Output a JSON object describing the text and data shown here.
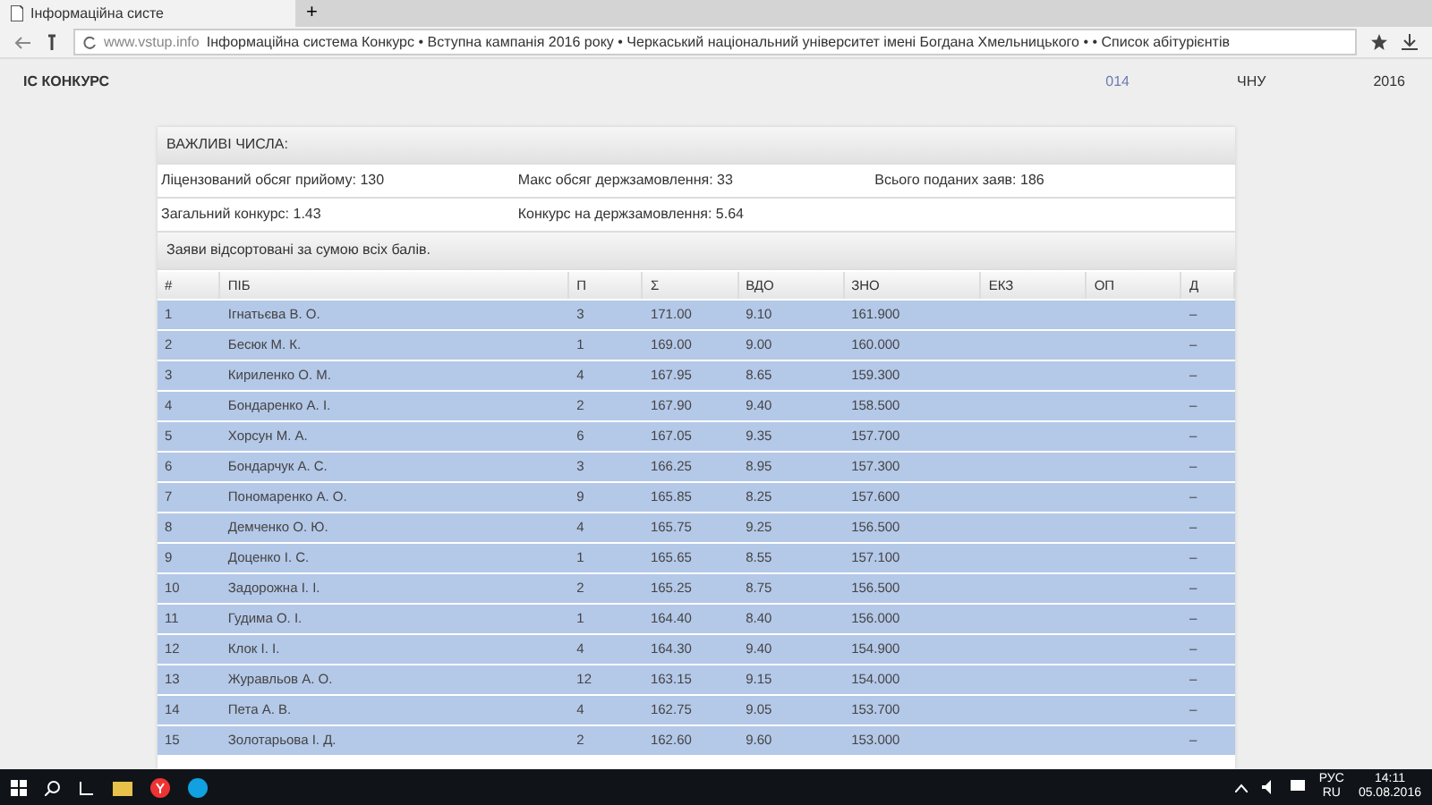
{
  "browser": {
    "tab": {
      "title": "Інформаційна систе",
      "selected": true
    },
    "new_tab": "+",
    "url_host": "www.vstup.info",
    "url_title": "Інформаційна система Конкурс • Вступна кампанія 2016 року • Черкаський національний університет імені Богдана Хмельницького • • Список абітурієнтів"
  },
  "navbar": {
    "brand": "ІС КОНКУРС",
    "links": [
      {
        "label": "014",
        "selected": true
      },
      {
        "label": "ЧНУ",
        "selected": false
      },
      {
        "label": "2016",
        "selected": false
      }
    ]
  },
  "panel": {
    "title": "ВАЖЛИВІ ЧИСЛА:",
    "stats": [
      [
        "Ліцензований обсяг прийому: 130",
        "Макс обсяг держзамовлення: 33",
        "Всього поданих заяв: 186"
      ],
      [
        "Загальний конкурс: 1.43",
        "Конкурс на держзамовлення: 5.64"
      ]
    ],
    "note": "Заяви відсортовані за сумою всіх балів."
  },
  "table": {
    "columns": [
      "#",
      "ПІБ",
      "П",
      "Σ",
      "ВДО",
      "ЗНО",
      "ЕКЗ",
      "ОП",
      "Д"
    ],
    "rows": [
      [
        "1",
        "Ігнатьєва В. О.",
        "3",
        "171.00",
        "9.10",
        "161.900",
        "",
        "",
        "–"
      ],
      [
        "2",
        "Бесюк М. К.",
        "1",
        "169.00",
        "9.00",
        "160.000",
        "",
        "",
        "–"
      ],
      [
        "3",
        "Кириленко О. М.",
        "4",
        "167.95",
        "8.65",
        "159.300",
        "",
        "",
        "–"
      ],
      [
        "4",
        "Бондаренко А. І.",
        "2",
        "167.90",
        "9.40",
        "158.500",
        "",
        "",
        "–"
      ],
      [
        "5",
        "Хорсун М. А.",
        "6",
        "167.05",
        "9.35",
        "157.700",
        "",
        "",
        "–"
      ],
      [
        "6",
        "Бондарчук А. С.",
        "3",
        "166.25",
        "8.95",
        "157.300",
        "",
        "",
        "–"
      ],
      [
        "7",
        "Пономаренко А. О.",
        "9",
        "165.85",
        "8.25",
        "157.600",
        "",
        "",
        "–"
      ],
      [
        "8",
        "Демченко О. Ю.",
        "4",
        "165.75",
        "9.25",
        "156.500",
        "",
        "",
        "–"
      ],
      [
        "9",
        "Доценко І. С.",
        "1",
        "165.65",
        "8.55",
        "157.100",
        "",
        "",
        "–"
      ],
      [
        "10",
        "Задорожна І. І.",
        "2",
        "165.25",
        "8.75",
        "156.500",
        "",
        "",
        "–"
      ],
      [
        "11",
        "Гудима О. І.",
        "1",
        "164.40",
        "8.40",
        "156.000",
        "",
        "",
        "–"
      ],
      [
        "12",
        "Клок І. І.",
        "4",
        "164.30",
        "9.40",
        "154.900",
        "",
        "",
        "–"
      ],
      [
        "13",
        "Журавльов А. О.",
        "12",
        "163.15",
        "9.15",
        "154.000",
        "",
        "",
        "–"
      ],
      [
        "14",
        "Пета А. В.",
        "4",
        "162.75",
        "9.05",
        "153.700",
        "",
        "",
        "–"
      ],
      [
        "15",
        "Золотарьова І. Д.",
        "2",
        "162.60",
        "9.60",
        "153.000",
        "",
        "",
        "–"
      ]
    ]
  },
  "taskbar": {
    "language": "РУС",
    "layout": "RU",
    "time": "14:11",
    "date": "05.08.2016"
  }
}
